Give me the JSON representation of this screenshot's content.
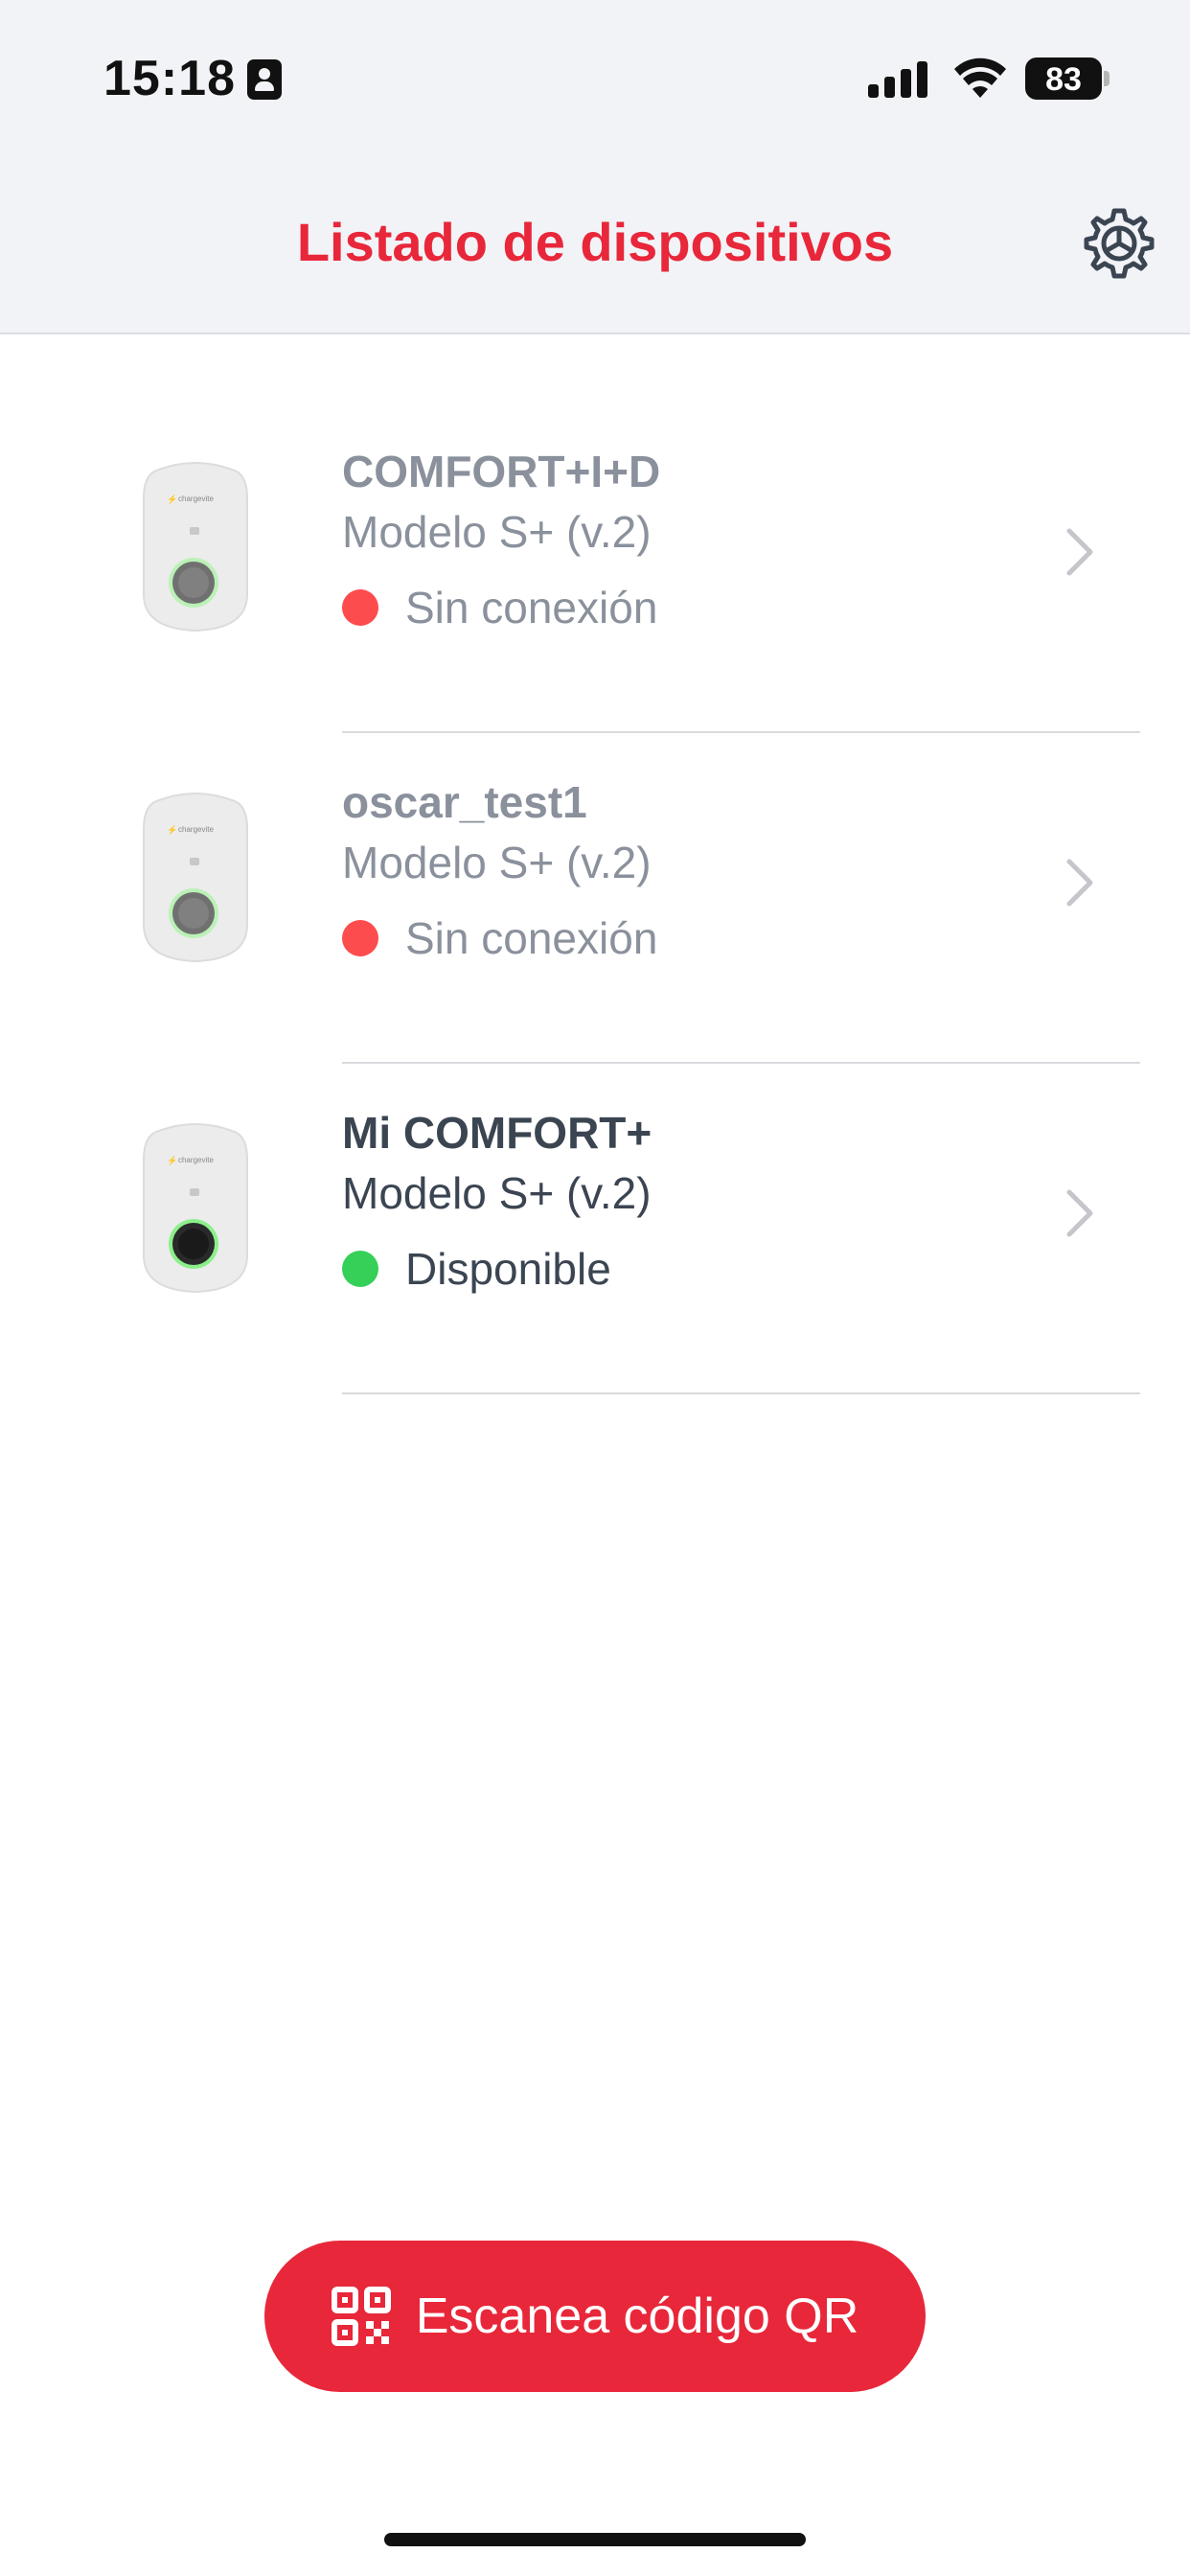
{
  "status_bar": {
    "time": "15:18",
    "battery_percent": "83",
    "icons": [
      "id-card-icon",
      "cellular-signal-icon",
      "wifi-icon",
      "battery-icon"
    ]
  },
  "header": {
    "title": "Listado de dispositivos",
    "settings_icon": "gear-icon"
  },
  "devices": [
    {
      "name": "COMFORT+I+D",
      "model": "Modelo S+ (v.2)",
      "status": "Sin conexión",
      "status_color": "#fc4c4e",
      "online": false
    },
    {
      "name": "oscar_test1",
      "model": "Modelo S+ (v.2)",
      "status": "Sin conexión",
      "status_color": "#fc4c4e",
      "online": false
    },
    {
      "name": "Mi COMFORT+",
      "model": "Modelo S+ (v.2)",
      "status": "Disponible",
      "status_color": "#34d058",
      "online": true
    }
  ],
  "scan_button": {
    "label": "Escanea código QR",
    "icon": "qr-code-icon"
  },
  "colors": {
    "accent": "#e8273a",
    "offline": "#fc4c4e",
    "available": "#34d058",
    "muted_text": "#8a919c",
    "active_text": "#3b4552"
  }
}
